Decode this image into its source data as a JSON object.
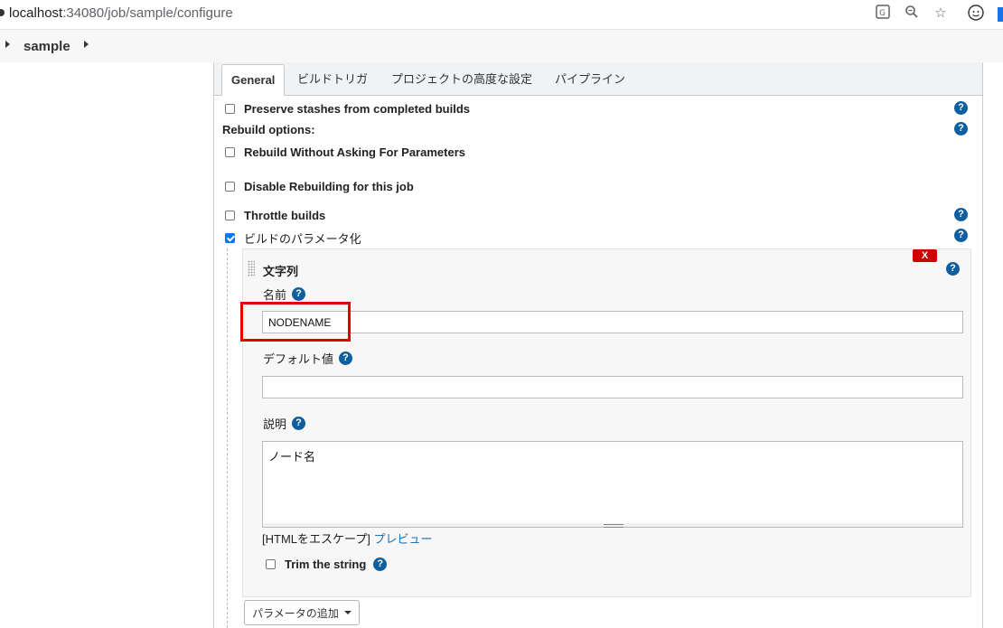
{
  "browser": {
    "url_host": "localhost",
    "url_path": ":34080/job/sample/configure",
    "icons": [
      "translate-icon",
      "zoom-icon",
      "star-icon",
      "profile-icon",
      "extension-icon"
    ]
  },
  "breadcrumb": {
    "job": "sample"
  },
  "tabs": [
    {
      "label": "General",
      "active": true
    },
    {
      "label": "ビルドトリガ"
    },
    {
      "label": "プロジェクトの高度な設定"
    },
    {
      "label": "パイプライン"
    }
  ],
  "options": {
    "preserve_stashes": "Preserve stashes from completed builds",
    "rebuild_options": "Rebuild options:",
    "rebuild_without_asking": "Rebuild Without Asking For Parameters",
    "disable_rebuilding": "Disable Rebuilding for this job",
    "throttle_builds": "Throttle builds",
    "parameterized": "ビルドのパラメータ化"
  },
  "parameter": {
    "type_label": "文字列",
    "delete_label": "X",
    "name_label": "名前",
    "name_value": "NODENAME",
    "default_label": "デフォルト値",
    "default_value": "",
    "description_label": "説明",
    "description_value": "ノード名",
    "escape_text": "[HTMLをエスケープ]",
    "preview_link": "プレビュー",
    "trim_label": "Trim the string"
  },
  "add_parameter_button": "パラメータの追加",
  "help_glyph": "?",
  "colors": {
    "help": "#0f5f9e",
    "delete": "#cc0000",
    "highlight": "#e00000",
    "link": "#1f6fb5"
  }
}
